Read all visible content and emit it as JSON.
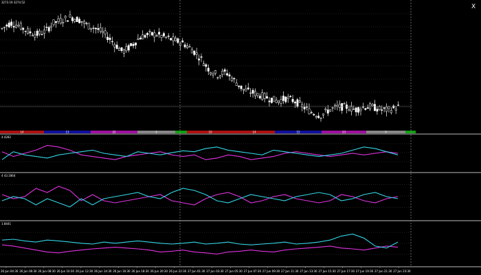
{
  "chart": {
    "price_label": "3273.19 3274.52",
    "close_symbol": "X",
    "colors": {
      "background": "#000000",
      "candle": "#ffffff",
      "cyan": "#33d6e6",
      "magenta": "#e233e2",
      "grid": "#555555",
      "separator": "#bbbbbb"
    }
  },
  "session_bar": [
    {
      "color": "#b01010",
      "label": "14"
    },
    {
      "color": "#1010a0",
      "label": "13"
    },
    {
      "color": "#a010a0",
      "label": "22"
    },
    {
      "color": "#888888",
      "label": "2"
    },
    {
      "color": "#10a010",
      "label": ""
    },
    {
      "color": "#b01010",
      "label": "10"
    },
    {
      "color": "#b01010",
      "label": "14"
    },
    {
      "color": "#1010a0",
      "label": "15"
    },
    {
      "color": "#a010a0",
      "label": "23"
    },
    {
      "color": "#888888",
      "label": "5"
    },
    {
      "color": "#10a010",
      "label": ""
    }
  ],
  "indicators": [
    {
      "label": "4.4282"
    },
    {
      "label": "4 43.1864"
    },
    {
      "label": "1.8441"
    }
  ],
  "time_labels": [
    "26 Jun 04:30",
    "26 Jun 06:30",
    "26 Jun 08:30",
    "26 Jun 10:30",
    "26 Jun 12:30",
    "26 Jun 14:30",
    "26 Jun 16:30",
    "26 Jun 18:30",
    "26 Jun 20:30",
    "26 Jun 22:30",
    "27 Jun 01:30",
    "27 Jun 03:30",
    "27 Jun 05:30",
    "27 Jun 07:30",
    "27 Jun 09:30",
    "27 Jun 11:30",
    "27 Jun 13:30",
    "27 Jun 15:30",
    "27 Jun 17:30",
    "27 Jun 19:30",
    "27 Jun 21:30",
    "27 Jun 23:30"
  ],
  "chart_data": {
    "type": "line",
    "title": "",
    "price_panel": {
      "close_series": [
        3273,
        3275,
        3274,
        3272,
        3271,
        3272,
        3275,
        3276,
        3277,
        3276,
        3274,
        3273,
        3271,
        3268,
        3265,
        3267,
        3270,
        3271,
        3271,
        3270,
        3269,
        3268,
        3266,
        3263,
        3259,
        3257,
        3258,
        3255,
        3252,
        3251,
        3250,
        3249,
        3248,
        3249,
        3248,
        3246,
        3244,
        3243,
        3245,
        3246,
        3246,
        3245,
        3246,
        3246,
        3245,
        3245,
        3246
      ]
    },
    "indicators": [
      {
        "cyan": [
          30,
          55,
          45,
          40,
          35,
          45,
          50,
          55,
          60,
          50,
          45,
          40,
          55,
          50,
          45,
          52,
          58,
          55,
          65,
          70,
          60,
          55,
          50,
          45,
          60,
          55,
          50,
          45,
          40,
          45,
          50,
          60,
          70,
          65,
          55,
          45
        ],
        "magenta": [
          55,
          40,
          50,
          60,
          75,
          70,
          60,
          45,
          40,
          35,
          30,
          40,
          45,
          50,
          55,
          45,
          40,
          45,
          30,
          35,
          45,
          40,
          30,
          35,
          40,
          50,
          55,
          50,
          45,
          40,
          45,
          50,
          45,
          50,
          55,
          50
        ]
      },
      {
        "cyan": [
          40,
          50,
          45,
          30,
          45,
          35,
          25,
          45,
          30,
          45,
          50,
          55,
          60,
          50,
          45,
          60,
          70,
          65,
          55,
          40,
          35,
          45,
          55,
          50,
          45,
          40,
          50,
          55,
          60,
          55,
          40,
          45,
          55,
          60,
          50,
          45
        ],
        "magenta": [
          55,
          45,
          50,
          70,
          60,
          75,
          65,
          40,
          55,
          40,
          35,
          40,
          45,
          50,
          55,
          40,
          35,
          30,
          45,
          55,
          60,
          50,
          35,
          40,
          50,
          55,
          45,
          40,
          35,
          40,
          55,
          50,
          40,
          35,
          45,
          50
        ]
      },
      {
        "cyan": [
          60,
          62,
          58,
          55,
          60,
          58,
          55,
          52,
          50,
          55,
          52,
          55,
          58,
          55,
          52,
          50,
          52,
          55,
          50,
          52,
          55,
          50,
          48,
          50,
          52,
          55,
          50,
          52,
          55,
          60,
          70,
          75,
          65,
          45,
          40,
          55
        ],
        "magenta": [
          48,
          45,
          40,
          35,
          30,
          28,
          32,
          35,
          38,
          40,
          42,
          40,
          38,
          35,
          30,
          32,
          35,
          30,
          28,
          25,
          30,
          32,
          35,
          32,
          30,
          35,
          38,
          40,
          42,
          45,
          40,
          38,
          35,
          40,
          45,
          42
        ]
      }
    ]
  }
}
